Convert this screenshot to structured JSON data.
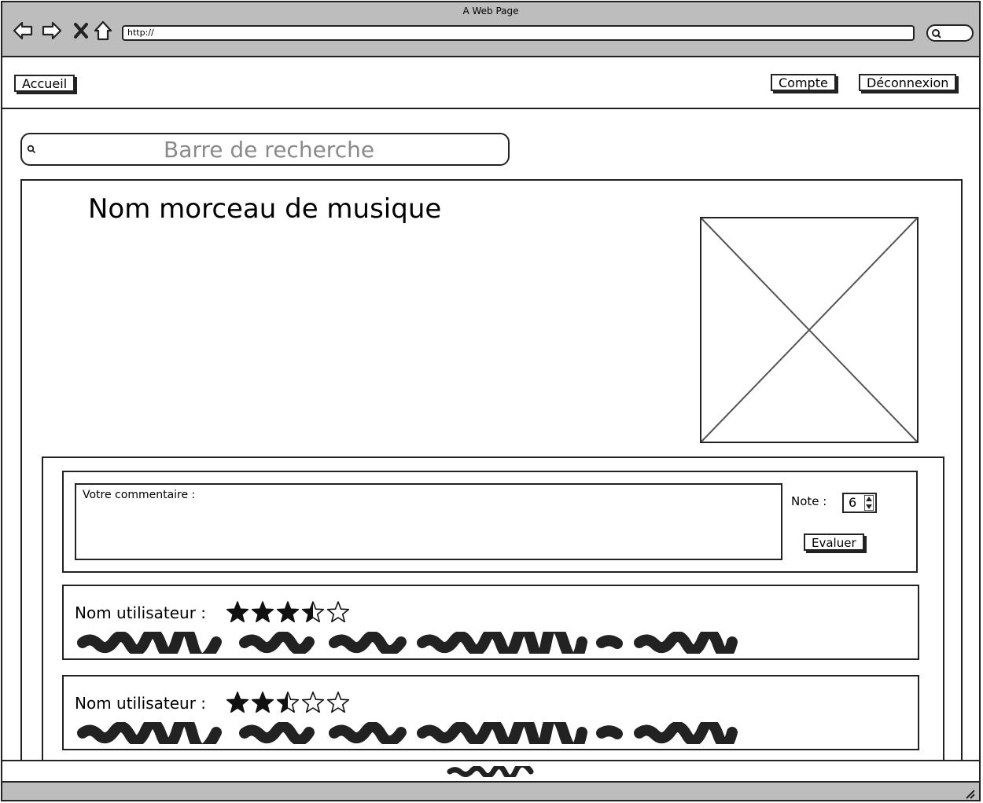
{
  "browser": {
    "window_title": "A Web Page",
    "url": "http://"
  },
  "topnav": {
    "home_label": "Accueil",
    "account_label": "Compte",
    "logout_label": "Déconnexion"
  },
  "search": {
    "placeholder": "Barre de recherche"
  },
  "song": {
    "title": "Nom morceau de musique"
  },
  "comment_form": {
    "comment_label": "Votre commentaire :",
    "note_label": "Note :",
    "note_value": "6",
    "submit_label": "Evaluer"
  },
  "reviews": [
    {
      "user_label": "Nom utilisateur :",
      "rating": 3.5,
      "rating_max": 5
    },
    {
      "user_label": "Nom utilisateur :",
      "rating": 2.5,
      "rating_max": 5
    }
  ],
  "colors": {
    "chrome": "#bdbdbd",
    "line": "#222222",
    "placeholder_text": "#8a8a8a"
  }
}
